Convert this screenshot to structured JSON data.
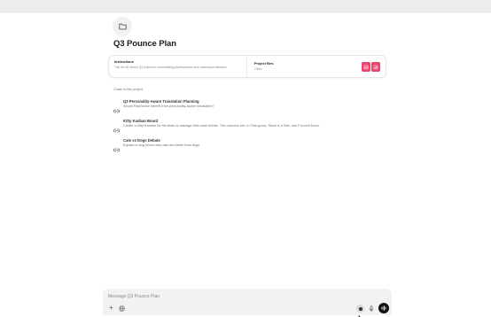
{
  "project": {
    "title": "Q3 Pounce Plan",
    "icon": "folder-icon"
  },
  "instructions": {
    "title": "Instructions",
    "text": "This the ND team's Q3 project for consolidating planning topics and roadmap prioritization."
  },
  "project_files": {
    "title": "Project files",
    "count": "2 files",
    "icons": [
      "file-icon",
      "file-icon"
    ],
    "color": "#e6466b"
  },
  "chats": {
    "label": "Chats in this project",
    "items": [
      {
        "title": "Q3 Personality-Aware Translation Planning",
        "subtitle": "Would PawSense benefit from personality-aware translation?",
        "icon": "chat-link-icon"
      },
      {
        "title": "Kitty Kanban Board",
        "subtitle": "Create a Kitty Kanban for the team to manage their work tickets. The columns are: In Paw-gress, Stuck in a Box, and Fur-real Done.",
        "icon": "chat-link-icon"
      },
      {
        "title": "Cats vs Dogs Debate",
        "subtitle": "Explain to dog lovers why cats are better than dogs",
        "icon": "chat-link-icon"
      }
    ]
  },
  "composer": {
    "placeholder": "Message Q3 Pounce Plan",
    "value": "",
    "buttons": [
      "plus-icon",
      "globe-icon",
      "record-icon",
      "mic-icon",
      "voice-mode-icon"
    ]
  }
}
